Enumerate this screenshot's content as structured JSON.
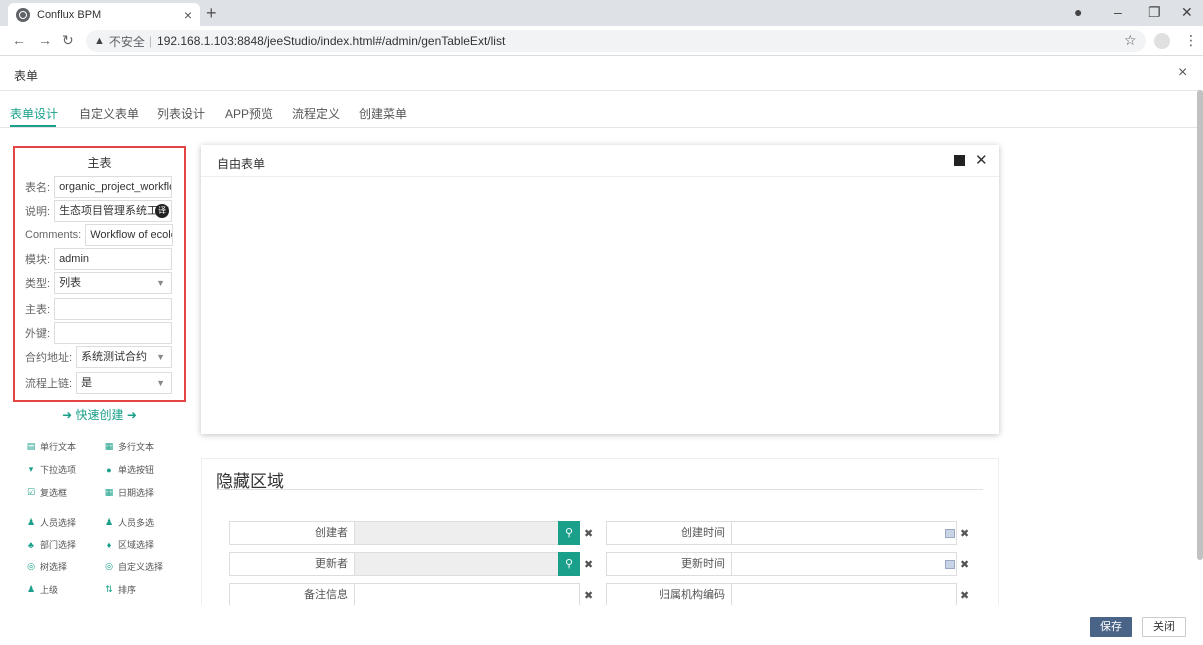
{
  "browser": {
    "tab_title": "Conflux BPM",
    "tab_close": "×",
    "new_tab": "+",
    "insecure_label": "不安全",
    "url": "192.168.1.103:8848/jeeStudio/index.html#/admin/genTableExt/list"
  },
  "dialog": {
    "title": "表单",
    "close": "×"
  },
  "tabs": [
    {
      "label": "表单设计",
      "active": true
    },
    {
      "label": "自定义表单"
    },
    {
      "label": "列表设计"
    },
    {
      "label": "APP预览"
    },
    {
      "label": "流程定义"
    },
    {
      "label": "创建菜单"
    }
  ],
  "main_table": {
    "title": "主表",
    "fields": [
      {
        "label": "表名:",
        "value": "organic_project_workflow"
      },
      {
        "label": "说明:",
        "value": "生态项目管理系统工作",
        "badge": "译"
      },
      {
        "label": "Comments:",
        "value": "Workflow of ecolog"
      },
      {
        "label": "模块:",
        "value": "admin"
      },
      {
        "label": "类型:",
        "value": "列表",
        "select": true
      },
      {
        "label": "主表:",
        "value": ""
      },
      {
        "label": "外键:",
        "value": ""
      },
      {
        "label": "合约地址:",
        "value": "系统测试合约",
        "select": true
      },
      {
        "label": "流程上链:",
        "value": "是",
        "select": true
      }
    ]
  },
  "quick_create": "快速创建",
  "widgets": [
    {
      "label": "单行文本",
      "icon": "single-line-text-icon",
      "glyph": "▤"
    },
    {
      "label": "多行文本",
      "icon": "multi-line-text-icon",
      "glyph": "▦"
    },
    {
      "label": "下拉选项",
      "icon": "dropdown-icon",
      "glyph": "▾"
    },
    {
      "label": "单选按钮",
      "icon": "radio-icon",
      "glyph": "●"
    },
    {
      "label": "复选框",
      "icon": "checkbox-icon",
      "glyph": "☑"
    },
    {
      "label": "日期选择",
      "icon": "calendar-icon",
      "glyph": "▦"
    },
    {
      "label": "人员选择",
      "icon": "user-icon",
      "glyph": "♟"
    },
    {
      "label": "人员多选",
      "icon": "users-icon",
      "glyph": "♟"
    },
    {
      "label": "部门选择",
      "icon": "department-icon",
      "glyph": "♣"
    },
    {
      "label": "区域选择",
      "icon": "location-icon",
      "glyph": "♦"
    },
    {
      "label": "树选择",
      "icon": "tree-search-icon",
      "glyph": "◎"
    },
    {
      "label": "自定义选择",
      "icon": "custom-search-icon",
      "glyph": "◎"
    },
    {
      "label": "上级",
      "icon": "parent-icon",
      "glyph": "♟"
    },
    {
      "label": "排序",
      "icon": "sort-icon",
      "glyph": "⇅"
    }
  ],
  "free_form": {
    "title": "自由表单"
  },
  "hidden_area": {
    "title": "隐藏区域",
    "rows": [
      {
        "left_label": "创建者",
        "right_label": "创建时间"
      },
      {
        "left_label": "更新者",
        "right_label": "更新时间"
      },
      {
        "left_label": "备注信息",
        "right_label": "归属机构编码"
      }
    ]
  },
  "footer": {
    "save": "保存",
    "close": "关闭"
  },
  "colors": {
    "accent": "#1aa08a",
    "highlight_border": "#e34444",
    "save_button": "#4a6487"
  }
}
